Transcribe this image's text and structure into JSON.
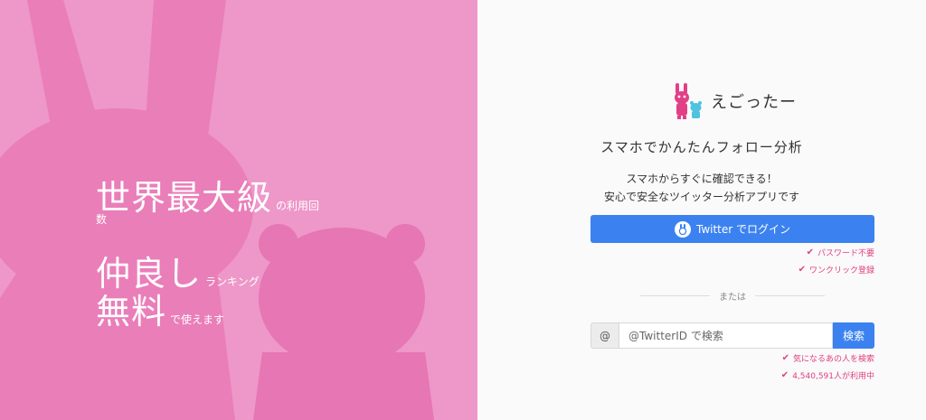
{
  "tagline": {
    "line1_big": "世界最大級",
    "line1_small": "の利用回",
    "line1_wrap": "数",
    "line2_big": "仲良し",
    "line2_small": "ランキング",
    "line3_big": "無料",
    "line3_small": "で使えます"
  },
  "brand": {
    "name": "えごったー"
  },
  "subtitle": "スマホでかんたんフォロー分析",
  "description": {
    "line1": "スマホからすぐに確認できる！",
    "line2": "安心で安全なツイッター分析アプリです"
  },
  "login": {
    "label": "Twitter でログイン"
  },
  "login_features": [
    "パスワード不要",
    "ワンクリック登録"
  ],
  "divider_text": "または",
  "search": {
    "prefix": "@",
    "placeholder": "@TwitterID で検索",
    "button_label": "検索"
  },
  "search_features": [
    "気になるあの人を検索",
    "4,540,591人が利用中"
  ],
  "colors": {
    "left_bg": "#ee97c9",
    "silhouette": "#ea7eb9",
    "primary_blue": "#3b82f0",
    "check_pink": "#e0407f"
  }
}
